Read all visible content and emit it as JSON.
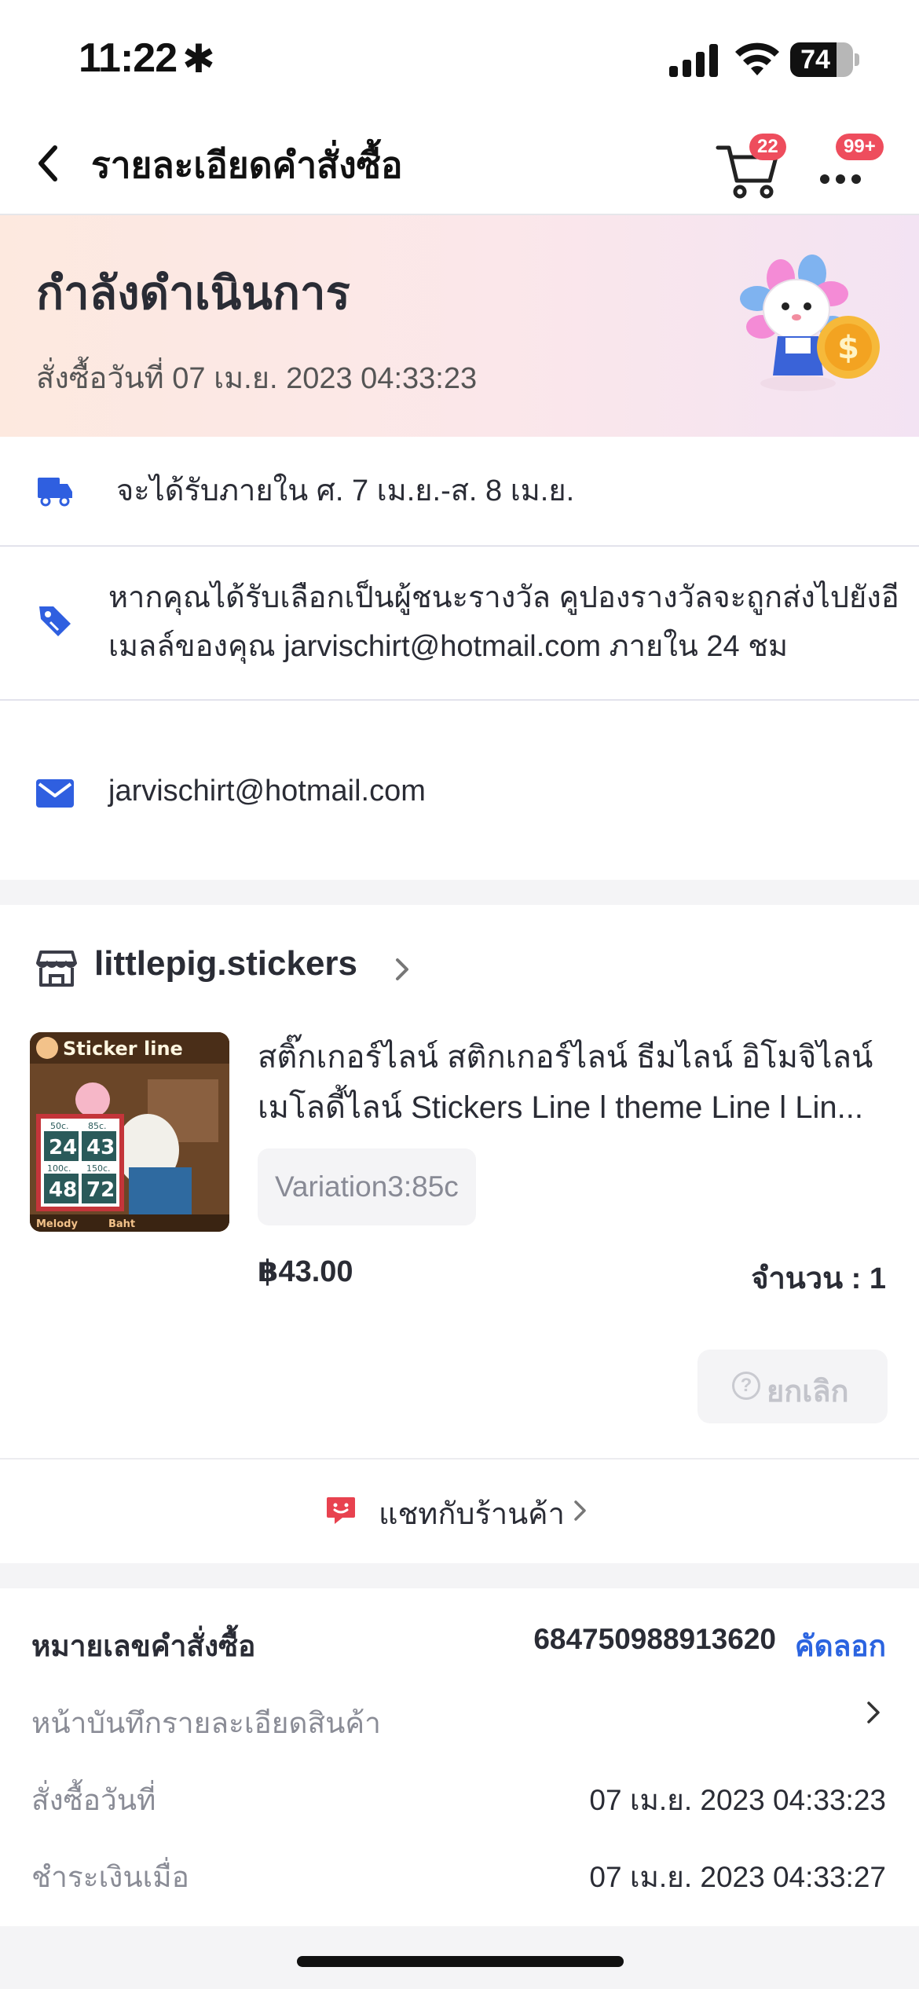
{
  "status_bar": {
    "time": "11:22",
    "glyph": "✱",
    "battery": "74",
    "battery_level": 0.74
  },
  "nav": {
    "title": "รายละเอียดคำสั่งซื้อ",
    "cart_badge": "22",
    "more_badge": "99+"
  },
  "banner": {
    "title": "กำลังดำเนินการ",
    "order_date": "สั่งซื้อวันที่ 07 เม.ย. 2023  04:33:23"
  },
  "delivery": {
    "text": "จะได้รับภายใน ศ. 7 เม.ย.-ส. 8 เม.ย."
  },
  "coupon": {
    "line1": "หากคุณได้รับเลือกเป็นผู้ชนะรางวัล คูปองรางวัลจะถูกส่งไปยังอี",
    "line2": "เมลล์ของคุณ jarvischirt@hotmail.com ภายใน 24 ชม"
  },
  "email": {
    "address": "jarvischirt@hotmail.com"
  },
  "shop": {
    "name": "littlepig.stickers",
    "product": {
      "title_line1": "สติ๊กเกอร์ไลน์ สติกเกอร์ไลน์ ธีมไลน์ อิโมจิไลน์",
      "title_line2": "เมโลดี้ไลน์ Stickers Line l theme Line l Lin...",
      "variation": "Variation3:85c",
      "price": "฿43.00",
      "quantity": "จำนวน : 1",
      "image_texts": {
        "banner": "Sticker line",
        "p1": "50c.",
        "v1": "24",
        "p2": "85c.",
        "v2": "43",
        "p3": "100c.",
        "v3": "48",
        "p4": "150c.",
        "v4": "72",
        "unit": "Baht",
        "footer_left": "Melody",
        "footer_right": "Baht"
      }
    },
    "cancel_label": "ยกเลิก",
    "chat_label": "แชทกับร้านค้า"
  },
  "order": {
    "number_label": "หมายเลขคำสั่งซื้อ",
    "number": "684750988913620",
    "copy_label": "คัดลอก",
    "snapshot_label": "หน้าบันทึกรายละเอียดสินค้า",
    "ordered_label": "สั่งซื้อวันที่",
    "ordered_value": "07 เม.ย. 2023  04:33:23",
    "paid_label": "ชำระเงินเมื่อ",
    "paid_value": "07 เม.ย. 2023  04:33:27"
  },
  "colors": {
    "accent_blue": "#2b64e0",
    "badge_red": "#ee4d5d",
    "icon_blue": "#2f5fe0",
    "chat_red": "#e8424f"
  }
}
